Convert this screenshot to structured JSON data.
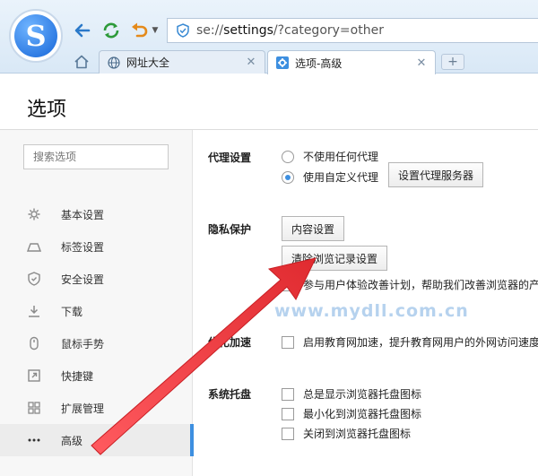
{
  "browser": {
    "address": {
      "scheme": "se://",
      "host": "settings",
      "path": "/?category=other"
    },
    "tabs": [
      {
        "label": "网址大全",
        "icon": "globe-icon",
        "active": false
      },
      {
        "label": "选项-高级",
        "icon": "gear-icon",
        "active": true
      }
    ],
    "new_tab_label": "+",
    "close_glyph": "✕"
  },
  "page": {
    "title": "选项"
  },
  "sidebar": {
    "search_placeholder": "搜索选项",
    "items": [
      {
        "label": "基本设置",
        "icon": "gear-icon"
      },
      {
        "label": "标签设置",
        "icon": "tab-icon"
      },
      {
        "label": "安全设置",
        "icon": "shield-icon"
      },
      {
        "label": "下载",
        "icon": "download-icon"
      },
      {
        "label": "鼠标手势",
        "icon": "mouse-icon"
      },
      {
        "label": "快捷键",
        "icon": "shortcut-icon"
      },
      {
        "label": "扩展管理",
        "icon": "extensions-icon"
      },
      {
        "label": "高级",
        "icon": "more-icon",
        "active": true
      }
    ]
  },
  "settings": {
    "proxy": {
      "label": "代理设置",
      "option_none": "不使用任何代理",
      "option_custom": "使用自定义代理",
      "selected": "custom",
      "button": "设置代理服务器"
    },
    "privacy": {
      "label": "隐私保护",
      "content_button": "内容设置",
      "clear_button": "清除浏览记录设置",
      "participate": "参与用户体验改善计划，帮助我们改善浏览器的产"
    },
    "optimize": {
      "label": "优化加速",
      "edu": "启用教育网加速，提升教育网用户的外网访问速度"
    },
    "tray": {
      "label": "系统托盘",
      "opt1": "总是显示浏览器托盘图标",
      "opt2": "最小化到浏览器托盘图标",
      "opt3": "关闭到浏览器托盘图标"
    }
  },
  "watermark": "www.mydll.com.cn",
  "colors": {
    "accent": "#3d8fe0",
    "arrow": "#e8383d"
  }
}
